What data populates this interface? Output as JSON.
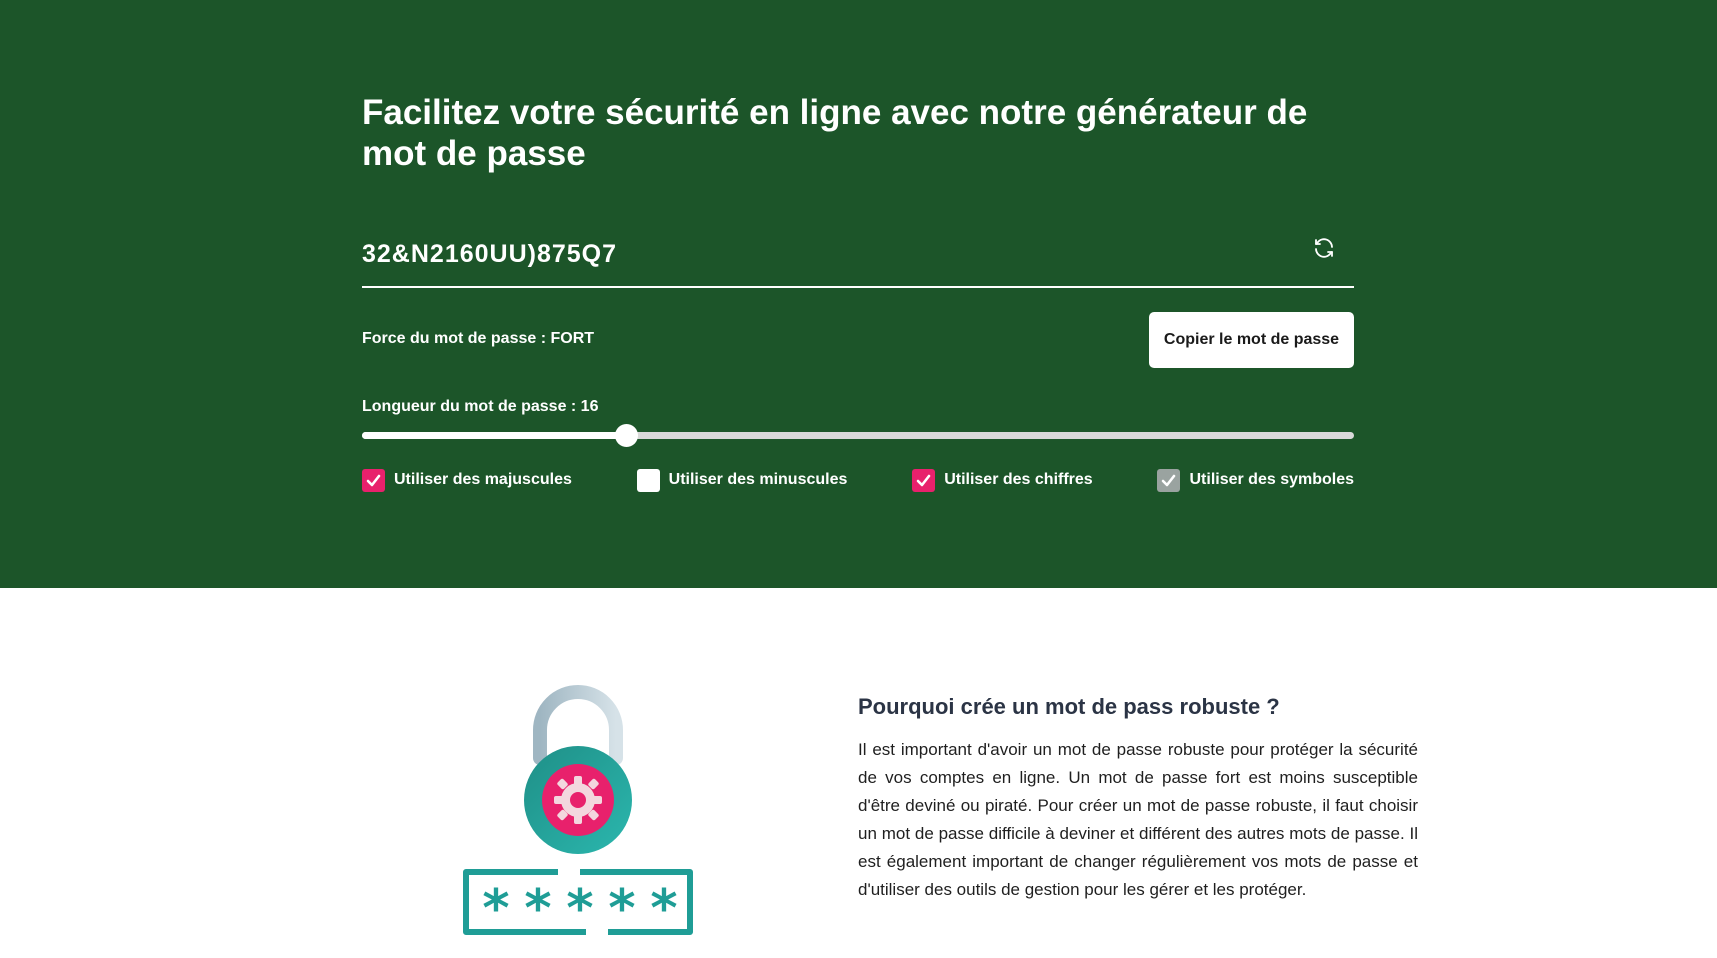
{
  "hero": {
    "title": "Facilitez votre sécurité en ligne avec notre générateur de mot de passe",
    "password": "32&N2160UU)875Q7",
    "refresh_icon": "refresh-icon",
    "strength_text": "Force du mot de passe : FORT",
    "copy_button": "Copier le mot de passe",
    "length_label": "Longueur du mot de passe : 16",
    "slider": {
      "value": 16,
      "fraction": 0.266
    },
    "options": [
      {
        "label": "Utiliser des majuscules",
        "state": "checked"
      },
      {
        "label": "Utiliser des minuscules",
        "state": "unchecked"
      },
      {
        "label": "Utiliser des chiffres",
        "state": "checked"
      },
      {
        "label": "Utiliser des symboles",
        "state": "checked-disabled"
      }
    ]
  },
  "info": {
    "title": "Pourquoi crée un mot de pass robuste ?",
    "text": "Il est important d'avoir un mot de passe robuste pour protéger la sécurité de vos comptes en ligne. Un mot de passe fort est moins susceptible d'être deviné ou piraté. Pour créer un mot de passe robuste, il faut choisir un mot de passe difficile à deviner et différent des autres mots de passe. Il est également important de changer régulièrement vos mots de passe et d'utiliser des outils de gestion pour les gérer et les protéger.",
    "illustration": "padlock-password-illustration"
  },
  "colors": {
    "hero_bg": "#1c5529",
    "accent": "#e8216c",
    "teal": "#1f9d96"
  }
}
